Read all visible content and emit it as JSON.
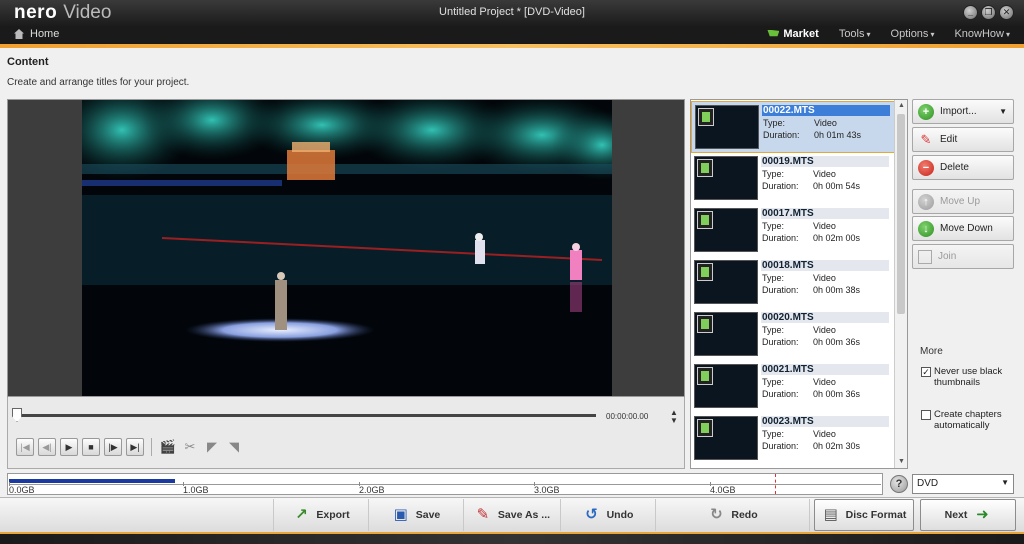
{
  "window": {
    "brand": "nero",
    "product": "Video",
    "title": "Untitled Project * [DVD-Video]",
    "controls": [
      "_",
      "❐",
      "✕"
    ]
  },
  "nav": {
    "home": "Home",
    "menu": [
      {
        "label": "Market",
        "caret": ""
      },
      {
        "label": "Tools",
        "caret": "▾"
      },
      {
        "label": "Options",
        "caret": "▾"
      },
      {
        "label": "KnowHow",
        "caret": "▾"
      }
    ]
  },
  "content": {
    "title": "Content",
    "description": "Create and arrange titles for your project."
  },
  "player": {
    "timecode": "00:00:00.00"
  },
  "clips": {
    "type_label": "Type:",
    "duration_label": "Duration:",
    "items": [
      {
        "name": "00022.MTS",
        "type": "Video",
        "duration": "0h 01m 43s",
        "selected": true
      },
      {
        "name": "00019.MTS",
        "type": "Video",
        "duration": "0h 00m 54s",
        "selected": false
      },
      {
        "name": "00017.MTS",
        "type": "Video",
        "duration": "0h 02m 00s",
        "selected": false
      },
      {
        "name": "00018.MTS",
        "type": "Video",
        "duration": "0h 00m 38s",
        "selected": false
      },
      {
        "name": "00020.MTS",
        "type": "Video",
        "duration": "0h 00m 36s",
        "selected": false
      },
      {
        "name": "00021.MTS",
        "type": "Video",
        "duration": "0h 00m 36s",
        "selected": false
      },
      {
        "name": "00023.MTS",
        "type": "Video",
        "duration": "0h 02m 30s",
        "selected": false
      }
    ]
  },
  "actions": {
    "import": "Import...",
    "edit": "Edit",
    "delete": "Delete",
    "move_up": "Move Up",
    "move_down": "Move Down",
    "join": "Join"
  },
  "more": {
    "title": "More",
    "never_black": {
      "label": "Never use black thumbnails",
      "checked": true
    },
    "chapters": {
      "label": "Create chapters automatically",
      "checked": false
    }
  },
  "capacity": {
    "used_fraction": 0.19,
    "ticks": [
      "0.0GB",
      "1.0GB",
      "2.0GB",
      "3.0GB",
      "4.0GB"
    ]
  },
  "disc": {
    "selected": "DVD"
  },
  "toolbar": {
    "export": "Export",
    "save": "Save",
    "save_as": "Save As ...",
    "undo": "Undo",
    "redo": "Redo",
    "disc_format": "Disc Format",
    "next": "Next"
  }
}
